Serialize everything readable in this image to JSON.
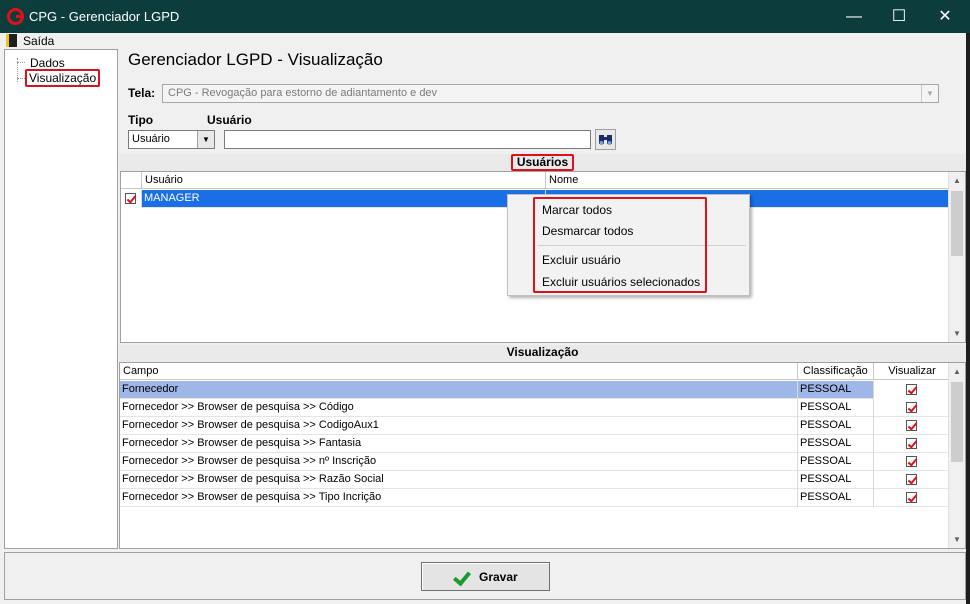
{
  "window": {
    "title": "CPG - Gerenciador LGPD",
    "minimize": "—",
    "maximize": "☐",
    "close": "✕"
  },
  "menu": {
    "exit_label": "Saída"
  },
  "tree": {
    "items": [
      {
        "label": "Dados"
      },
      {
        "label": "Visualização"
      }
    ]
  },
  "main": {
    "title": "Gerenciador LGPD - Visualização",
    "tela_label": "Tela:",
    "tela_value": "CPG - Revogação para estorno de adiantamento e dev",
    "tipo_label": "Tipo",
    "usuario_label": "Usuário",
    "tipo_value": "Usuário",
    "usuario_value": ""
  },
  "users_panel": {
    "title": "Usuários",
    "columns": [
      "Usuário",
      "Nome"
    ],
    "rows": [
      {
        "usuario": "MANAGER",
        "nome": "",
        "checked": true
      }
    ]
  },
  "context_menu": {
    "items": [
      "Marcar todos",
      "Desmarcar todos",
      "Excluir usuário",
      "Excluir usuários selecionados"
    ]
  },
  "visualizacao_panel": {
    "title": "Visualização",
    "columns": [
      "Campo",
      "Classificação",
      "Visualizar"
    ],
    "rows": [
      {
        "campo": "Fornecedor",
        "classificacao": "PESSOAL",
        "visualizar": true
      },
      {
        "campo": "Fornecedor >> Browser de pesquisa >> Código",
        "classificacao": "PESSOAL",
        "visualizar": true
      },
      {
        "campo": "Fornecedor >> Browser de pesquisa >> CodigoAux1",
        "classificacao": "PESSOAL",
        "visualizar": true
      },
      {
        "campo": "Fornecedor >> Browser de pesquisa >> Fantasia",
        "classificacao": "PESSOAL",
        "visualizar": true
      },
      {
        "campo": "Fornecedor >> Browser de pesquisa >> nº Inscrição",
        "classificacao": "PESSOAL",
        "visualizar": true
      },
      {
        "campo": "Fornecedor >> Browser de pesquisa >> Razão Social",
        "classificacao": "PESSOAL",
        "visualizar": true
      },
      {
        "campo": "Fornecedor >> Browser de pesquisa >> Tipo Incrição",
        "classificacao": "PESSOAL",
        "visualizar": true
      }
    ]
  },
  "footer": {
    "save_label": "Gravar"
  },
  "colors": {
    "titlebar": "#0c3d3c",
    "selection_blue": "#1a6fe6",
    "selection_soft": "#9fb6e8",
    "highlight_red": "#e0101a",
    "check_green": "#1e9a2a"
  }
}
